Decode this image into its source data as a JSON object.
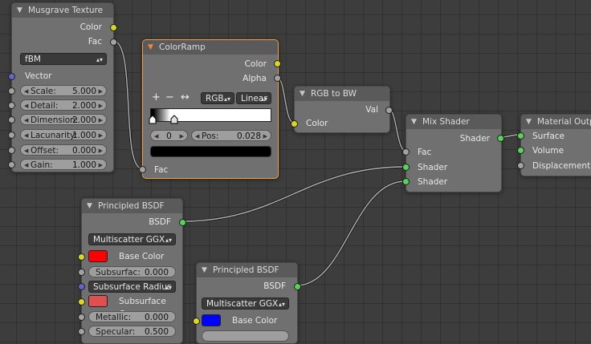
{
  "colors": {
    "node_body": "#707070",
    "node_header": "#5a5a5a",
    "selected_outline": "#f0a040",
    "socket_color": "#d8d824",
    "socket_float": "#a2a2a2",
    "socket_shader": "#56d456",
    "socket_vector": "#6464cc"
  },
  "musgrave": {
    "title": "Musgrave Texture",
    "out_color": "Color",
    "out_fac": "Fac",
    "type": "fBM",
    "in_vector": "Vector",
    "fields": [
      {
        "label": "Scale:",
        "value": "5.000"
      },
      {
        "label": "Detail:",
        "value": "2.000"
      },
      {
        "label": "Dimension:",
        "value": "2.000"
      },
      {
        "label": "Lacunarity:",
        "value": "1.000"
      },
      {
        "label": "Offset:",
        "value": "0.000"
      },
      {
        "label": "Gain:",
        "value": "1.000"
      }
    ]
  },
  "colorramp": {
    "title": "ColorRamp",
    "out_color": "Color",
    "out_alpha": "Alpha",
    "add": "+",
    "remove": "−",
    "flip": "↔",
    "color_mode": "RGB",
    "interpolation": "Linear",
    "index": "0",
    "pos_label": "Pos:",
    "pos_value": "0.028",
    "in_fac": "Fac"
  },
  "rgbtobw": {
    "title": "RGB to BW",
    "out_val": "Val",
    "in_color": "Color"
  },
  "mixshader": {
    "title": "Mix Shader",
    "out_shader": "Shader",
    "in_fac": "Fac",
    "in_shader1": "Shader",
    "in_shader2": "Shader"
  },
  "matout": {
    "title": "Material Output",
    "in_surface": "Surface",
    "in_volume": "Volume",
    "in_displacement": "Displacement"
  },
  "bsdf1": {
    "title": "Principled BSDF",
    "out_bsdf": "BSDF",
    "distribution": "Multiscatter GGX",
    "base_color": "Base Color",
    "subsurface_label": "Subsurfac:",
    "subsurface_value": "0.000",
    "subsurface_radius": "Subsurface Radius",
    "subsurface_color": "Subsurface C...",
    "metallic_label": "Metallic:",
    "metallic_value": "0.000",
    "specular_label": "Specular:",
    "specular_value": "0.500",
    "base_swatch": "#ff0000",
    "sss_swatch": "#e05050"
  },
  "bsdf2": {
    "title": "Principled BSDF",
    "out_bsdf": "BSDF",
    "distribution": "Multiscatter GGX",
    "base_color": "Base Color",
    "base_swatch": "#0000ff"
  }
}
